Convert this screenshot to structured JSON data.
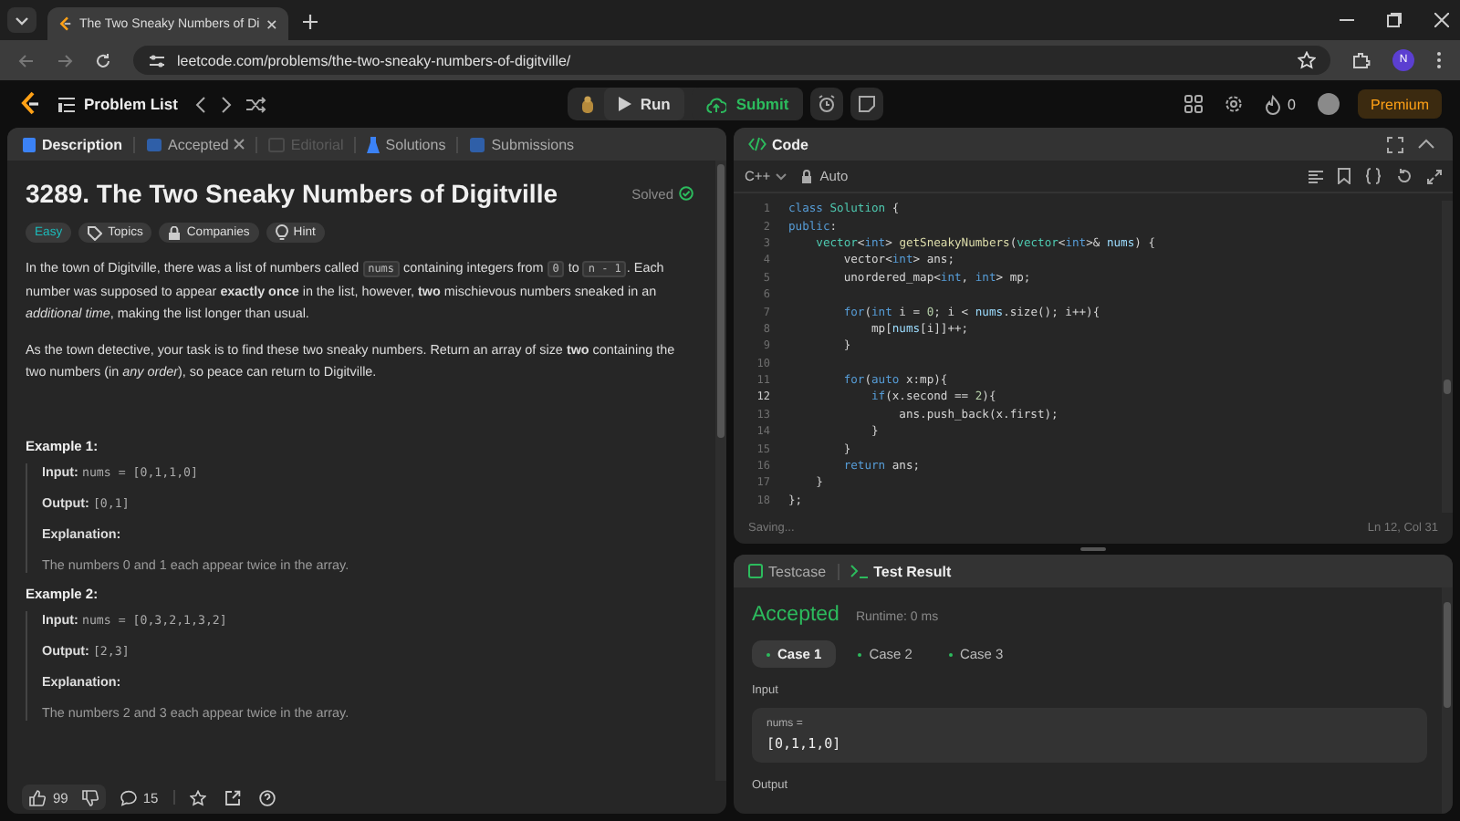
{
  "browser": {
    "tab_title": "The Two Sneaky Numbers of Di",
    "url": "leetcode.com/problems/the-two-sneaky-numbers-of-digitville/",
    "profile_initial": "N"
  },
  "nav": {
    "problem_list": "Problem List",
    "run": "Run",
    "submit": "Submit",
    "streak": "0",
    "premium": "Premium"
  },
  "description": {
    "tabs": [
      {
        "label": "Description",
        "kind": "description",
        "selected": true,
        "disabled": false,
        "closable": false
      },
      {
        "label": "Accepted",
        "kind": "accepted",
        "selected": false,
        "disabled": false,
        "closable": true
      },
      {
        "label": "Editorial",
        "kind": "editorial",
        "selected": false,
        "disabled": true,
        "closable": false
      },
      {
        "label": "Solutions",
        "kind": "solutions",
        "selected": false,
        "disabled": false,
        "closable": false
      },
      {
        "label": "Submissions",
        "kind": "submissions",
        "selected": false,
        "disabled": false,
        "closable": false
      }
    ],
    "title": "3289. The Two Sneaky Numbers of Digitville",
    "solved": "Solved",
    "tags": [
      {
        "label": "Easy",
        "kind": "difficulty"
      },
      {
        "label": "Topics",
        "kind": "topics"
      },
      {
        "label": "Companies",
        "kind": "companies"
      },
      {
        "label": "Hint",
        "kind": "hint"
      }
    ],
    "paragraphs": [
      [
        {
          "text": "In the town of Digitville, there was a list of numbers called ",
          "kind": "text"
        },
        {
          "text": "nums",
          "kind": "code"
        },
        {
          "text": " containing integers from ",
          "kind": "text"
        },
        {
          "text": "0",
          "kind": "code"
        },
        {
          "text": " to ",
          "kind": "text"
        },
        {
          "text": "n - 1",
          "kind": "code"
        },
        {
          "text": ". Each number was supposed to appear **exactly once** in the list, however, **two** mischievous numbers sneaked in an *additional time*, making the list longer than usual.",
          "kind": "text"
        }
      ],
      [
        {
          "text": "As the town detective, your task is to find these two sneaky numbers. Return an array of size **two** containing the two numbers (in *any order*), so peace can return to Digitville.",
          "kind": "text"
        }
      ]
    ],
    "examples": [
      {
        "title": "Example 1:",
        "input_label": "Input:",
        "input": "nums = [0,1,1,0]",
        "output_label": "Output:",
        "output": "[0,1]",
        "explanation_label": "Explanation:",
        "explanation": "The numbers 0 and 1 each appear twice in the array."
      },
      {
        "title": "Example 2:",
        "input_label": "Input:",
        "input": "nums = [0,3,2,1,3,2]",
        "output_label": "Output:",
        "output": "[2,3]",
        "explanation_label": "Explanation:",
        "explanation": "The numbers 2 and 3 each appear twice in the array."
      }
    ],
    "likes": "99",
    "comments": "15"
  },
  "editor": {
    "title": "Code",
    "language": "C++",
    "mode": "Auto",
    "lines": [
      {
        "number": "1",
        "current": false,
        "tokens": [
          {
            "text": "class ",
            "kind": "kw"
          },
          {
            "text": "Solution",
            "kind": "type"
          },
          {
            "text": " {",
            "kind": "plain"
          }
        ]
      },
      {
        "number": "2",
        "current": false,
        "tokens": [
          {
            "text": "public",
            "kind": "kw"
          },
          {
            "text": ":",
            "kind": "plain"
          }
        ]
      },
      {
        "number": "3",
        "current": false,
        "tokens": [
          {
            "text": "    vector",
            "kind": "type"
          },
          {
            "text": "<",
            "kind": "plain"
          },
          {
            "text": "int",
            "kind": "kw"
          },
          {
            "text": "> ",
            "kind": "plain"
          },
          {
            "text": "getSneakyNumbers",
            "kind": "fn"
          },
          {
            "text": "(",
            "kind": "plain"
          },
          {
            "text": "vector",
            "kind": "type"
          },
          {
            "text": "<",
            "kind": "plain"
          },
          {
            "text": "int",
            "kind": "kw"
          },
          {
            "text": ">& ",
            "kind": "plain"
          },
          {
            "text": "nums",
            "kind": "var"
          },
          {
            "text": ") {",
            "kind": "plain"
          }
        ]
      },
      {
        "number": "4",
        "current": false,
        "tokens": [
          {
            "text": "        vector<",
            "kind": "plain"
          },
          {
            "text": "int",
            "kind": "kw"
          },
          {
            "text": "> ans;",
            "kind": "plain"
          }
        ]
      },
      {
        "number": "5",
        "current": false,
        "tokens": [
          {
            "text": "        unordered_map<",
            "kind": "plain"
          },
          {
            "text": "int",
            "kind": "kw"
          },
          {
            "text": ", ",
            "kind": "plain"
          },
          {
            "text": "int",
            "kind": "kw"
          },
          {
            "text": "> mp;",
            "kind": "plain"
          }
        ]
      },
      {
        "number": "6",
        "current": false
      },
      {
        "number": "7",
        "current": false,
        "tokens": [
          {
            "text": "        for",
            "kind": "kw"
          },
          {
            "text": "(",
            "kind": "plain"
          },
          {
            "text": "int",
            "kind": "kw"
          },
          {
            "text": " i = ",
            "kind": "plain"
          },
          {
            "text": "0",
            "kind": "num"
          },
          {
            "text": "; i < ",
            "kind": "plain"
          },
          {
            "text": "nums",
            "kind": "var"
          },
          {
            "text": ".size(); i++){",
            "kind": "plain"
          }
        ]
      },
      {
        "number": "8",
        "current": false,
        "tokens": [
          {
            "text": "            mp[",
            "kind": "plain"
          },
          {
            "text": "nums",
            "kind": "var"
          },
          {
            "text": "[i]]++;",
            "kind": "plain"
          }
        ]
      },
      {
        "number": "9",
        "current": false,
        "tokens": [
          {
            "text": "        }",
            "kind": "plain"
          }
        ]
      },
      {
        "number": "10",
        "current": false
      },
      {
        "number": "11",
        "current": false,
        "tokens": [
          {
            "text": "        for",
            "kind": "kw"
          },
          {
            "text": "(",
            "kind": "plain"
          },
          {
            "text": "auto",
            "kind": "kw"
          },
          {
            "text": " x:mp){",
            "kind": "plain"
          }
        ]
      },
      {
        "number": "12",
        "current": true,
        "tokens": [
          {
            "text": "            if",
            "kind": "kw"
          },
          {
            "text": "(x.second == ",
            "kind": "plain"
          },
          {
            "text": "2",
            "kind": "num"
          },
          {
            "text": "){",
            "kind": "plain"
          }
        ]
      },
      {
        "number": "13",
        "current": false,
        "tokens": [
          {
            "text": "                ans.push_back(x.first);",
            "kind": "plain"
          }
        ]
      },
      {
        "number": "14",
        "current": false,
        "tokens": [
          {
            "text": "            }",
            "kind": "plain"
          }
        ]
      },
      {
        "number": "15",
        "current": false,
        "tokens": [
          {
            "text": "        }",
            "kind": "plain"
          }
        ]
      },
      {
        "number": "16",
        "current": false,
        "tokens": [
          {
            "text": "        return",
            "kind": "kw"
          },
          {
            "text": " ans;",
            "kind": "plain"
          }
        ]
      },
      {
        "number": "17",
        "current": false,
        "tokens": [
          {
            "text": "    }",
            "kind": "plain"
          }
        ]
      },
      {
        "number": "18",
        "current": false,
        "tokens": [
          {
            "text": "};",
            "kind": "plain"
          }
        ]
      }
    ],
    "status": "Saving...",
    "cursor": "Ln 12, Col 31"
  },
  "results": {
    "tabs": [
      {
        "label": "Testcase",
        "kind": "testcase",
        "selected": false
      },
      {
        "label": "Test Result",
        "kind": "result",
        "selected": true
      }
    ],
    "verdict": "Accepted",
    "runtime": "Runtime: 0 ms",
    "cases": [
      {
        "label": "Case 1",
        "selected": true
      },
      {
        "label": "Case 2",
        "selected": false
      },
      {
        "label": "Case 3",
        "selected": false
      }
    ],
    "input_label": "Input",
    "param": "nums =",
    "value": "[0,1,1,0]",
    "output_label": "Output"
  }
}
